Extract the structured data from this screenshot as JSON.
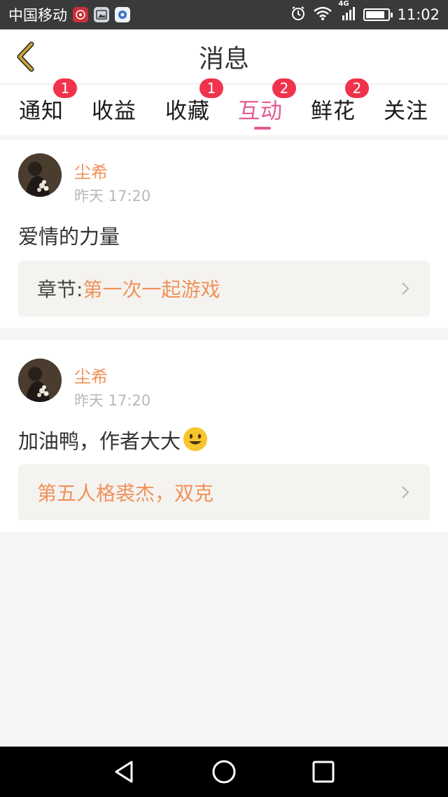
{
  "status_bar": {
    "carrier": "中国移动",
    "time": "11:02",
    "network": "4G",
    "battery_level": 0.85,
    "icons": [
      "app-red-icon",
      "gallery-icon",
      "app-blue-icon",
      "alarm-icon",
      "wifi-icon",
      "signal-icon",
      "battery-icon"
    ]
  },
  "header": {
    "title": "消息",
    "back_icon": "chevron-left-icon"
  },
  "tabs": [
    {
      "label": "通知",
      "badge": "1",
      "active": false
    },
    {
      "label": "收益",
      "badge": "",
      "active": false
    },
    {
      "label": "收藏",
      "badge": "1",
      "active": false
    },
    {
      "label": "互动",
      "badge": "2",
      "active": true
    },
    {
      "label": "鲜花",
      "badge": "2",
      "active": false
    },
    {
      "label": "关注",
      "badge": "",
      "active": false
    }
  ],
  "messages": [
    {
      "user": "尘希",
      "time": "昨天 17:20",
      "text": "爱情的力量",
      "chapter_prefix": "章节:",
      "chapter_title": "第一次一起游戏"
    },
    {
      "user": "尘希",
      "time": "昨天 17:20",
      "text": "加油鸭，作者大大",
      "emoji": "smiling-face-emoji",
      "chapter_prefix": "",
      "chapter_title": "第五人格裘杰，双克"
    }
  ],
  "colors": {
    "accent_pink": "#e25b91",
    "name_orange": "#f0915a",
    "badge_red": "#f0334b",
    "back_arrow": "#c9a33a"
  },
  "navbar": {
    "icons": [
      "back-triangle-icon",
      "home-circle-icon",
      "recents-square-icon"
    ]
  }
}
